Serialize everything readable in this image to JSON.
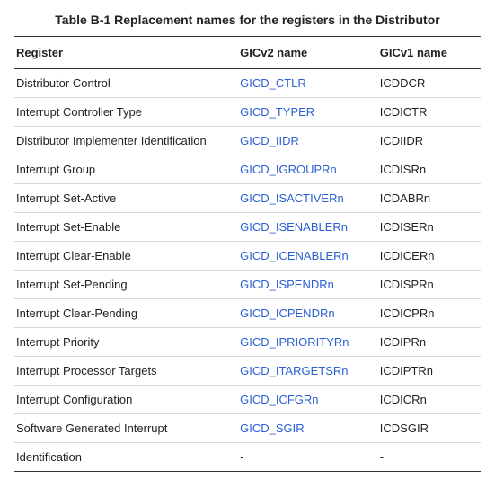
{
  "caption": "Table B-1 Replacement names for the registers in the Distributor",
  "columns": [
    "Register",
    "GICv2 name",
    "GICv1 name"
  ],
  "rows": [
    {
      "register": "Distributor Control",
      "gicv2": "GICD_CTLR",
      "gicv2_link": true,
      "gicv1": "ICDDCR"
    },
    {
      "register": "Interrupt Controller Type",
      "gicv2": "GICD_TYPER",
      "gicv2_link": true,
      "gicv1": "ICDICTR"
    },
    {
      "register": "Distributor Implementer Identification",
      "gicv2": "GICD_IIDR",
      "gicv2_link": true,
      "gicv1": "ICDIIDR"
    },
    {
      "register": "Interrupt Group",
      "gicv2": "GICD_IGROUPRn",
      "gicv2_link": true,
      "gicv1": "ICDISRn"
    },
    {
      "register": "Interrupt Set-Active",
      "gicv2": "GICD_ISACTIVERn",
      "gicv2_link": true,
      "gicv1": "ICDABRn"
    },
    {
      "register": "Interrupt Set-Enable",
      "gicv2": "GICD_ISENABLERn",
      "gicv2_link": true,
      "gicv1": "ICDISERn"
    },
    {
      "register": "Interrupt Clear-Enable",
      "gicv2": "GICD_ICENABLERn",
      "gicv2_link": true,
      "gicv1": "ICDICERn"
    },
    {
      "register": "Interrupt Set-Pending",
      "gicv2": "GICD_ISPENDRn",
      "gicv2_link": true,
      "gicv1": "ICDISPRn"
    },
    {
      "register": "Interrupt Clear-Pending",
      "gicv2": "GICD_ICPENDRn",
      "gicv2_link": true,
      "gicv1": "ICDICPRn"
    },
    {
      "register": "Interrupt Priority",
      "gicv2": "GICD_IPRIORITYRn",
      "gicv2_link": true,
      "gicv1": "ICDIPRn"
    },
    {
      "register": "Interrupt Processor Targets",
      "gicv2": "GICD_ITARGETSRn",
      "gicv2_link": true,
      "gicv1": "ICDIPTRn"
    },
    {
      "register": "Interrupt Configuration",
      "gicv2": "GICD_ICFGRn",
      "gicv2_link": true,
      "gicv1": "ICDICRn"
    },
    {
      "register": "Software Generated Interrupt",
      "gicv2": "GICD_SGIR",
      "gicv2_link": true,
      "gicv1": "ICDSGIR"
    },
    {
      "register": "Identification",
      "gicv2": "-",
      "gicv2_link": false,
      "gicv1": "-"
    }
  ]
}
